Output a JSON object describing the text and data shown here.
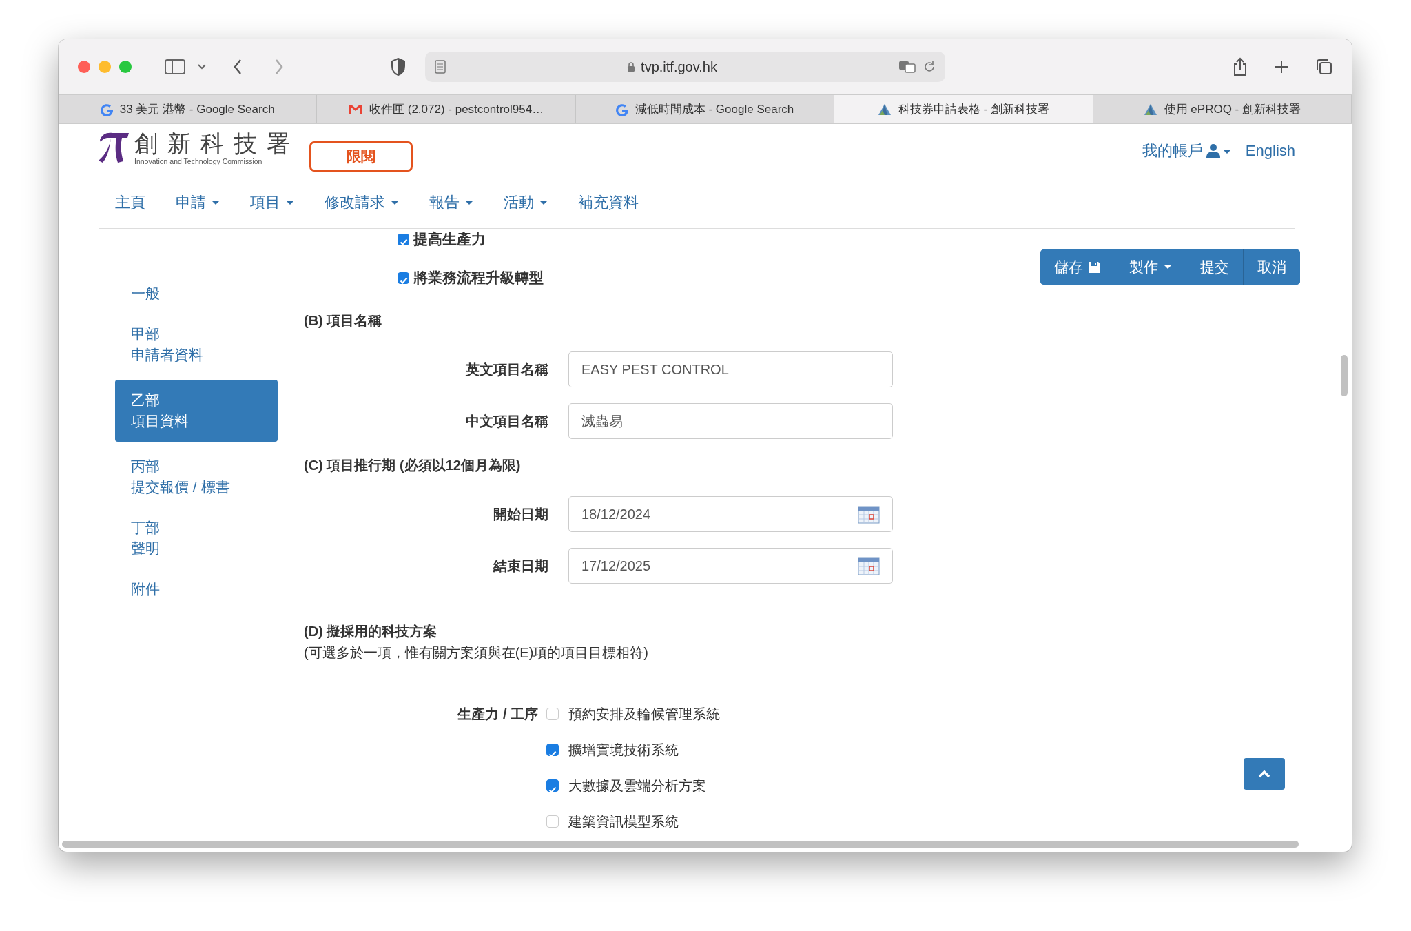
{
  "browser": {
    "url": "tvp.itf.gov.hk",
    "tabs": [
      {
        "title": "33 美元 港幣 - Google Search",
        "selected": false
      },
      {
        "title": "收件匣 (2,072) - pestcontrol954…",
        "selected": false
      },
      {
        "title": "減低時間成本 - Google Search",
        "selected": false
      },
      {
        "title": "科技券申請表格 - 創新科技署",
        "selected": true
      },
      {
        "title": "使用 ePROQ - 創新科技署",
        "selected": false
      }
    ]
  },
  "header": {
    "logo_title": "創新科技署",
    "logo_subtitle": "Innovation and Technology Commission",
    "badge": "限閱",
    "account": "我的帳戶",
    "language": "English",
    "nav": [
      {
        "label": "主頁",
        "dropdown": false
      },
      {
        "label": "申請",
        "dropdown": true
      },
      {
        "label": "項目",
        "dropdown": true
      },
      {
        "label": "修改請求",
        "dropdown": true
      },
      {
        "label": "報告",
        "dropdown": true
      },
      {
        "label": "活動",
        "dropdown": true
      },
      {
        "label": "補充資料",
        "dropdown": false
      }
    ]
  },
  "actions": [
    {
      "label": "儲存"
    },
    {
      "label": "製作"
    },
    {
      "label": "提交"
    },
    {
      "label": "取消"
    }
  ],
  "sidebar": [
    {
      "lines": [
        "一般"
      ],
      "selected": false
    },
    {
      "lines": [
        "甲部",
        "申請者資料"
      ],
      "selected": false
    },
    {
      "lines": [
        "乙部",
        "項目資料"
      ],
      "selected": true
    },
    {
      "lines": [
        "丙部",
        "提交報價 / 標書"
      ],
      "selected": false
    },
    {
      "lines": [
        "丁部",
        "聲明"
      ],
      "selected": false
    },
    {
      "lines": [
        "附件"
      ],
      "selected": false
    }
  ],
  "objectives": [
    {
      "label": "提高生產力",
      "checked": true
    },
    {
      "label": "將業務流程升級轉型",
      "checked": true
    }
  ],
  "sections": [
    {
      "title": "(B) 項目名稱",
      "fields": [
        {
          "label": "英文項目名稱",
          "value": "EASY PEST CONTROL",
          "kind": "text"
        },
        {
          "label": "中文項目名稱",
          "value": "滅蟲易",
          "kind": "text"
        }
      ]
    },
    {
      "title": "(C) 項目推行期 (必須以12個月為限)",
      "fields": [
        {
          "label": "開始日期",
          "value": "18/12/2024",
          "kind": "date"
        },
        {
          "label": "結束日期",
          "value": "17/12/2025",
          "kind": "date"
        }
      ]
    },
    {
      "title": "(D) 擬採用的科技方案",
      "note": "(可選多於一項，惟有關方案須與在(E)項的項目目標相符)",
      "groups": [
        {
          "label": "生產力 / 工序",
          "options": [
            {
              "label": "預約安排及輪候管理系統",
              "checked": false
            },
            {
              "label": "擴增實境技術系統",
              "checked": true
            },
            {
              "label": "大數據及雲端分析方案",
              "checked": true
            },
            {
              "label": "建築資訊模型系統",
              "checked": false
            }
          ]
        }
      ]
    }
  ]
}
